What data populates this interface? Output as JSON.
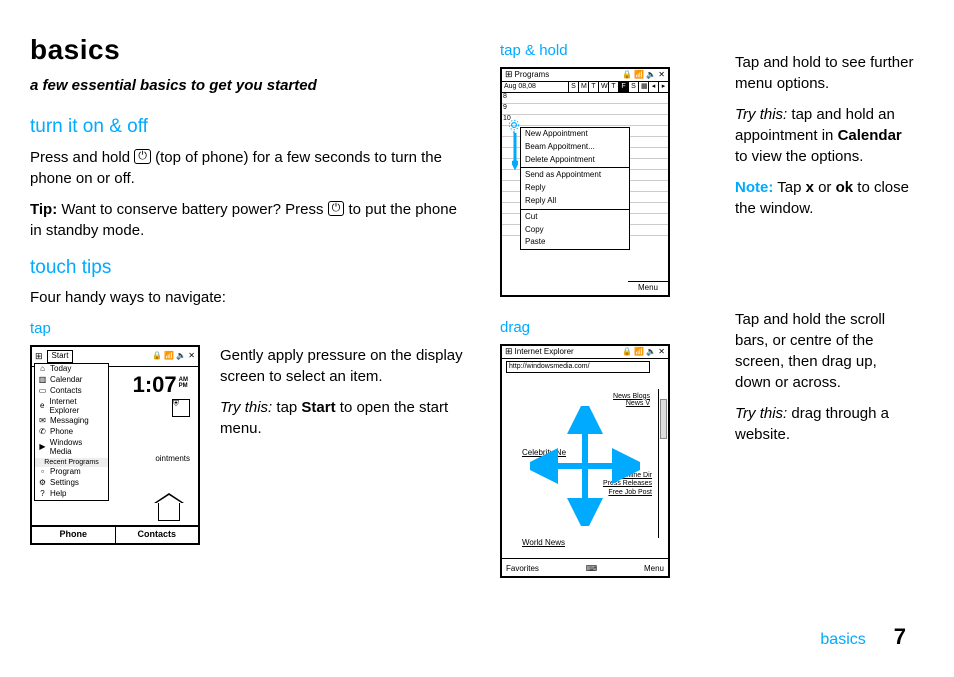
{
  "page": {
    "title": "basics",
    "subtitle": "a few essential basics to get you started",
    "footer_label": "basics",
    "footer_page": "7"
  },
  "sections": {
    "turn_on": {
      "heading": "turn it on & off",
      "p1a": "Press and hold ",
      "p1b": " (top of phone) for a few seconds to turn the phone on or off.",
      "tip_label": "Tip:",
      "tip_a": " Want to conserve battery power? Press ",
      "tip_b": " to put the phone in standby mode."
    },
    "touch_tips": {
      "heading": "touch tips",
      "intro": "Four handy ways to navigate:"
    },
    "tap": {
      "heading": "tap",
      "p1": "Gently apply pressure on the display screen to select an item.",
      "try_label": "Try this:",
      "try_a": " tap ",
      "try_b": " to open the start menu.",
      "start_word": "Start"
    },
    "taphold": {
      "heading": "tap & hold",
      "p1": "Tap and hold to see further menu options.",
      "try_label": "Try this:",
      "try_a": " tap and hold an appointment in ",
      "try_b": " to view the options.",
      "cal_word": "Calendar",
      "note_label": "Note:",
      "note_a": " Tap ",
      "note_x": "x",
      "note_or": " or ",
      "note_ok": "ok",
      "note_b": " to close the window."
    },
    "drag": {
      "heading": "drag",
      "p1": "Tap and hold the scroll bars, or centre of the screen, then drag up, down or across.",
      "try_label": "Try this:",
      "try_text": " drag through a website."
    }
  },
  "fig_tap": {
    "title": "Start",
    "time": "1:07",
    "am": "AM",
    "pm": "PM",
    "menu": [
      "Today",
      "Calendar",
      "Contacts",
      "Internet Explorer",
      "Messaging",
      "Phone",
      "Windows Media"
    ],
    "recent": "Recent Programs",
    "menu2": [
      "Program",
      "Settings",
      "Help"
    ],
    "bottom_left": "Phone",
    "bottom_right": "Contacts",
    "appts": "ointments"
  },
  "fig_hold": {
    "title": "Programs",
    "date": "Aug 08,08",
    "days": [
      "S",
      "M",
      "T",
      "W",
      "T",
      "F",
      "S"
    ],
    "active_day": 5,
    "hours": [
      "8",
      "9",
      "10"
    ],
    "ctx": [
      "New Appointment",
      "Beam Appoitment...",
      "Delete Appointment"
    ],
    "ctx2": [
      "Send as Appointment",
      "Reply",
      "Reply All"
    ],
    "ctx3": [
      "Cut",
      "Copy",
      "Paste"
    ],
    "menu": "Menu"
  },
  "fig_drag": {
    "title": "Internet Explorer",
    "url": "http://windowsmedia.com/",
    "top_links": [
      "News Blogs",
      "News V"
    ],
    "celeb": "Celebrity Ne",
    "world": "World News",
    "side_links": [
      "Online Dir",
      "Press Releases",
      "Free Job Post"
    ],
    "bottom_left": "Favorites",
    "bottom_right": "Menu"
  }
}
